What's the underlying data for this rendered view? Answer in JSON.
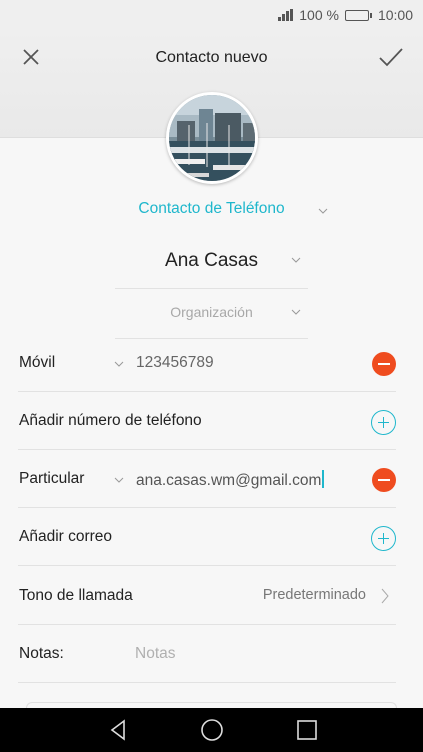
{
  "status_bar": {
    "signal": "signal-icon",
    "battery_percent": "100 %",
    "battery_level": 1.0,
    "time": "10:00"
  },
  "header": {
    "title": "Contacto nuevo",
    "close_icon": "close-icon",
    "confirm_icon": "checkmark-icon"
  },
  "avatar": {
    "icon": "contact-photo"
  },
  "account": {
    "label": "Contacto de Teléfono"
  },
  "name": {
    "value": "Ana Casas"
  },
  "organization": {
    "placeholder": "Organización"
  },
  "phone": {
    "type": "Móvil",
    "value": "123456789"
  },
  "add_phone": {
    "label": "Añadir número de teléfono"
  },
  "email": {
    "type": "Particular",
    "value": "ana.casas.wm@gmail.com"
  },
  "add_email": {
    "label": "Añadir correo"
  },
  "ringtone": {
    "label": "Tono de llamada",
    "value": "Predeterminado"
  },
  "notes": {
    "label": "Notas:",
    "placeholder": "Notas"
  },
  "colors": {
    "accent": "#1fb7cc",
    "remove": "#ef4c1f"
  }
}
